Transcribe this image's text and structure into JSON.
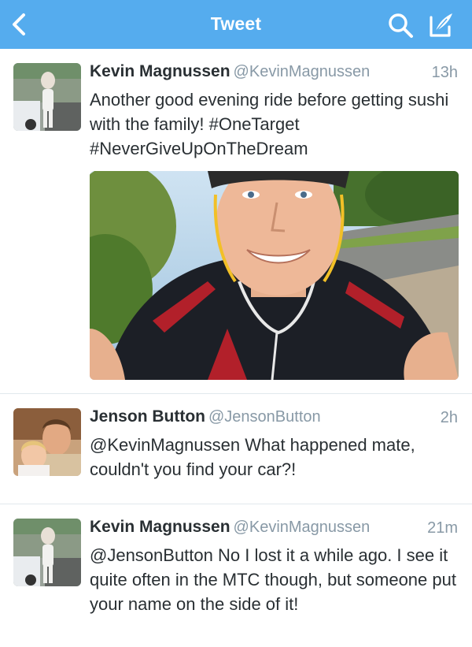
{
  "navbar": {
    "title": "Tweet",
    "back_icon": "chevron-left-icon",
    "search_icon": "search-icon",
    "compose_icon": "compose-icon",
    "color": "#55acee"
  },
  "tweets": [
    {
      "name": "Kevin Magnussen",
      "handle": "@KevinMagnussen",
      "time": "13h",
      "text": "Another good evening ride before getting sushi with the family! #OneTarget #NeverGiveUpOnTheDream",
      "has_media": true
    },
    {
      "name": "Jenson Button",
      "handle": "@JensonButton",
      "time": "2h",
      "text": "@KevinMagnussen What happened mate, couldn't you find your car?!"
    },
    {
      "name": "Kevin Magnussen",
      "handle": "@KevinMagnussen",
      "time": "21m",
      "text": "@JensonButton No I lost it a while ago. I see it quite often in the MTC though, but someone put your name on the side of it!"
    }
  ]
}
